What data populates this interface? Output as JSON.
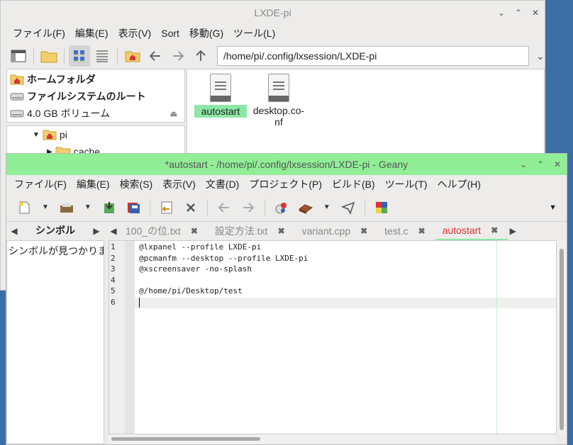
{
  "fm": {
    "title": "LXDE-pi",
    "menus": [
      "ファイル(F)",
      "編集(E)",
      "表示(V)",
      "Sort",
      "移動(G)",
      "ツール(L)"
    ],
    "path": "/home/pi/.config/lxsession/LXDE-pi",
    "places": [
      {
        "label": "ホームフォルダ",
        "icon": "home-icon"
      },
      {
        "label": "ファイルシステムのルート",
        "icon": "drive-icon"
      },
      {
        "label": "4.0 GB ボリューム",
        "icon": "drive-icon"
      }
    ],
    "tree": [
      {
        "label": "pi",
        "icon": "home-folder-icon"
      },
      {
        "label": "cache",
        "icon": "folder-icon"
      }
    ],
    "files": [
      {
        "name": "autostart"
      },
      {
        "name": "desktop.co-",
        "name2": "nf"
      }
    ]
  },
  "geany": {
    "title": "*autostart - /home/pi/.config/lxsession/LXDE-pi - Geany",
    "menus": [
      "ファイル(F)",
      "編集(E)",
      "検索(S)",
      "表示(V)",
      "文書(D)",
      "プロジェクト(P)",
      "ビルド(B)",
      "ツール(T)",
      "ヘルプ(H)"
    ],
    "sidebar_tab": "シンボル",
    "sidebar_text": "シンボルが見つかりません",
    "tabs": [
      "100_の位.txt",
      "設定方法.txt",
      "variant.cpp",
      "test.c",
      "autostart"
    ],
    "active_tab": 4,
    "line_numbers": [
      "1",
      "2",
      "3",
      "4",
      "5",
      "6"
    ],
    "lines": [
      "@lxpanel --profile LXDE-pi",
      "@pcmanfm --desktop --profile LXDE-pi",
      "@xscreensaver -no-splash",
      "",
      "@/home/pi/Desktop/test",
      ""
    ]
  },
  "colors": {
    "geany_titlebar": "#90ee96",
    "active_tab_text": "#dd3333",
    "selection": "#8ce8a4"
  }
}
